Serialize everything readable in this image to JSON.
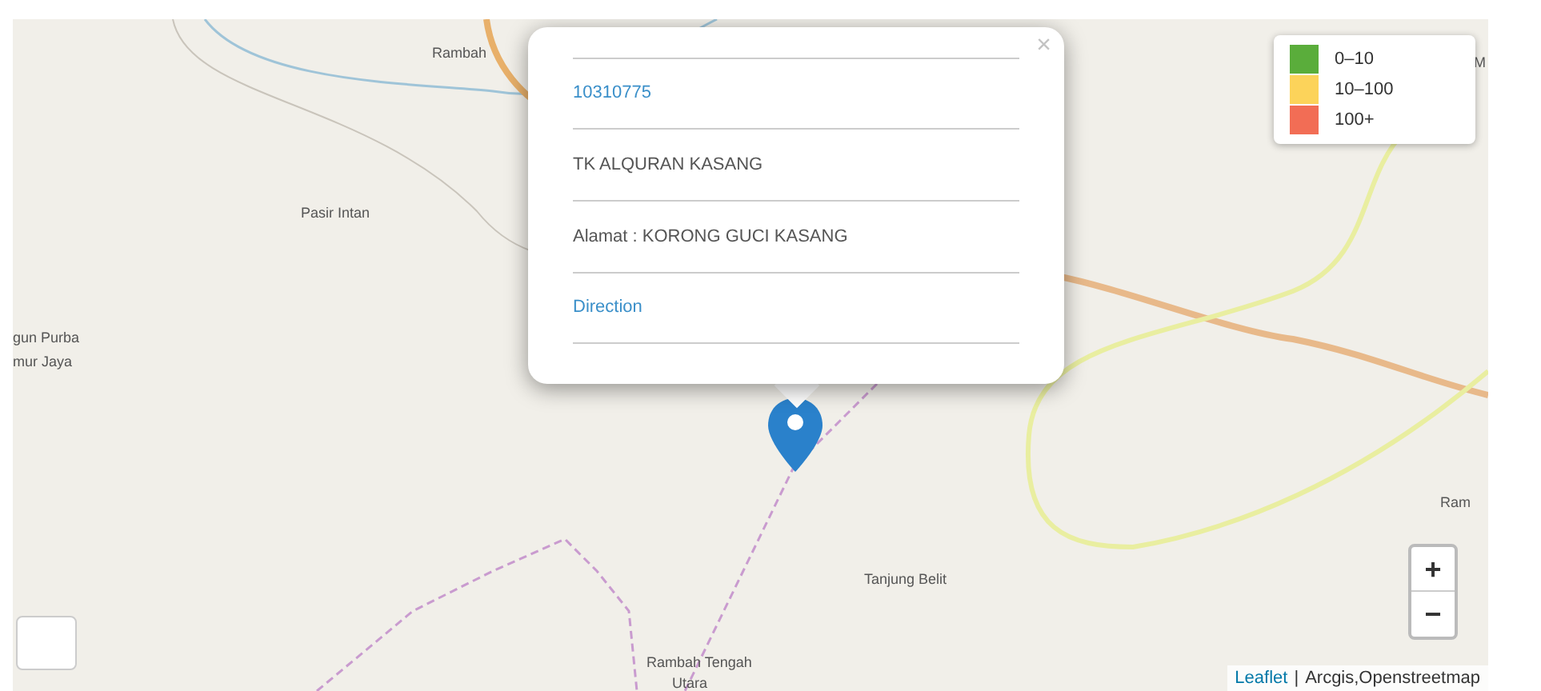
{
  "map": {
    "labels": [
      {
        "text": "Rambah"
      },
      {
        "text": "Pasir Intan"
      },
      {
        "text": "gun Purba"
      },
      {
        "text": "mur Jaya"
      },
      {
        "text": "M"
      },
      {
        "text": "Ram"
      },
      {
        "text": "Tanjung Belit"
      },
      {
        "text": "Rambah Tengah"
      },
      {
        "text": "Utara"
      }
    ]
  },
  "popup": {
    "close": "×",
    "code": "10310775",
    "name": "TK ALQURAN KASANG",
    "address": "Alamat : KORONG GUCI KASANG",
    "link": "Direction"
  },
  "legend": [
    {
      "label": "0–10",
      "color": "#5aad3b"
    },
    {
      "label": "10–100",
      "color": "#fcd35a"
    },
    {
      "label": "100+",
      "color": "#f26d55"
    }
  ],
  "zoom": {
    "in": "+",
    "out": "−"
  },
  "attribution": {
    "link": "Leaflet",
    "separator": "|",
    "text": "Arcgis,Openstreetmap"
  }
}
